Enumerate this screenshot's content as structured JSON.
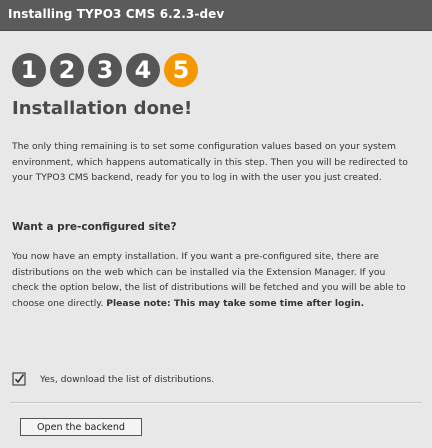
{
  "window": {
    "title": "Installing TYPO3 CMS 6.2.3-dev"
  },
  "steps": [
    "1",
    "2",
    "3",
    "4",
    "5"
  ],
  "active_step": "5",
  "heading": "Installation done!",
  "intro": "The only thing remaining is to set some configuration values based on your system environment, which happens automatically in this step. Then you will be redirected to your TYPO3 CMS backend, ready for you to log in with the user you just created.",
  "subheading": "Want a pre-configured site?",
  "body": "You now have an empty installation. If you want a pre-configured site, there are distributions on the web which can be installed via the Extension Manager. If you check the option below, the list of distributions will be fetched and you will be able to choose one directly. ",
  "note_label": "Please note: This may take some time after login.",
  "checkbox": {
    "label": "Yes, download the list of distributions.",
    "checked": true
  },
  "button": {
    "label": "Open the backend"
  },
  "colors": {
    "accent": "#f49700",
    "step": "#565656",
    "titlebar": "#5b5b5b"
  }
}
